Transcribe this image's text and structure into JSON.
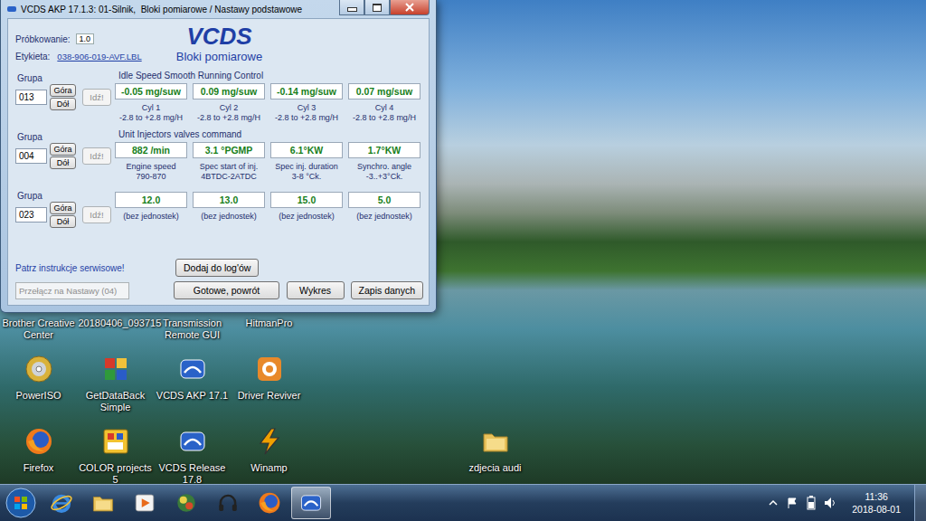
{
  "window": {
    "title": "VCDS AKP 17.1.3: 01-Silnik,  Bloki pomiarowe / Nastawy podstawowe",
    "sampling_label": "Próbkowanie:",
    "sampling_value": "1.0",
    "logo": "VCDS",
    "subtitle": "Bloki pomiarowe",
    "label_caption": "Etykieta:",
    "label_link": "038-906-019-AVF.LBL"
  },
  "groups": [
    {
      "caption": "Grupa",
      "number": "013",
      "up": "Góra",
      "down": "Dół",
      "go": {
        "label": "Idź!",
        "disabled": true
      },
      "title": "Idle Speed Smooth Running Control",
      "fields": [
        {
          "value": "-0.05 mg/suw",
          "name": "Cyl 1",
          "range": "-2.8 to +2.8 mg/H"
        },
        {
          "value": "0.09 mg/suw",
          "name": "Cyl 2",
          "range": "-2.8 to +2.8 mg/H"
        },
        {
          "value": "-0.14 mg/suw",
          "name": "Cyl 3",
          "range": "-2.8 to +2.8 mg/H"
        },
        {
          "value": "0.07 mg/suw",
          "name": "Cyl 4",
          "range": "-2.8 to +2.8 mg/H"
        }
      ]
    },
    {
      "caption": "Grupa",
      "number": "004",
      "up": "Góra",
      "down": "Dół",
      "go": {
        "label": "Idź!",
        "disabled": true
      },
      "title": "Unit Injectors valves command",
      "fields": [
        {
          "value": "882 /min",
          "name": "Engine speed",
          "range": "790-870"
        },
        {
          "value": "3.1 °PGMP",
          "name": "Spec start of inj.",
          "range": "4BTDC-2ATDC"
        },
        {
          "value": "6.1°KW",
          "name": "Spec inj. duration",
          "range": "3-8 °Ck."
        },
        {
          "value": "1.7°KW",
          "name": "Synchro. angle",
          "range": "-3..+3°Ck."
        }
      ]
    },
    {
      "caption": "Grupa",
      "number": "023",
      "up": "Góra",
      "down": "Dół",
      "go": {
        "label": "Idź!",
        "disabled": true
      },
      "fields": [
        {
          "value": "12.0",
          "name": "(bez jednostek)"
        },
        {
          "value": "13.0",
          "name": "(bez jednostek)"
        },
        {
          "value": "15.0",
          "name": "(bez jednostek)"
        },
        {
          "value": "5.0",
          "name": "(bez jednostek)"
        }
      ]
    }
  ],
  "footer": {
    "service_note": "Patrz instrukcje serwisowe!",
    "log_button": "Dodaj do log'ów",
    "switch_field": {
      "placeholder": "Przełącz na Nastawy (04)",
      "disabled": true
    },
    "buttons": [
      "Gotowe, powrót",
      "Wykres",
      "Zapis danych"
    ]
  },
  "desktop_icons": [
    {
      "label": "Brother Creative Center"
    },
    {
      "label": "20180406_093715"
    },
    {
      "label": "Transmission Remote GUI"
    },
    {
      "label": "HitmanPro"
    },
    {
      "label": "PowerISO"
    },
    {
      "label": "GetDataBack Simple"
    },
    {
      "label": "VCDS AKP 17.1"
    },
    {
      "label": "Driver Reviver"
    },
    {
      "label": "Firefox"
    },
    {
      "label": "COLOR projects 5"
    },
    {
      "label": "VCDS Release 17.8"
    },
    {
      "label": "Winamp"
    }
  ],
  "desktop_folder": {
    "label": "zdjecia audi"
  },
  "taskbar": {
    "pinned": [
      {
        "selected": false
      },
      {
        "selected": false
      },
      {
        "selected": false
      },
      {
        "selected": false
      },
      {
        "selected": false
      },
      {
        "selected": false
      },
      {
        "selected": true
      }
    ],
    "time": "11:36",
    "date": "2018-08-01"
  }
}
